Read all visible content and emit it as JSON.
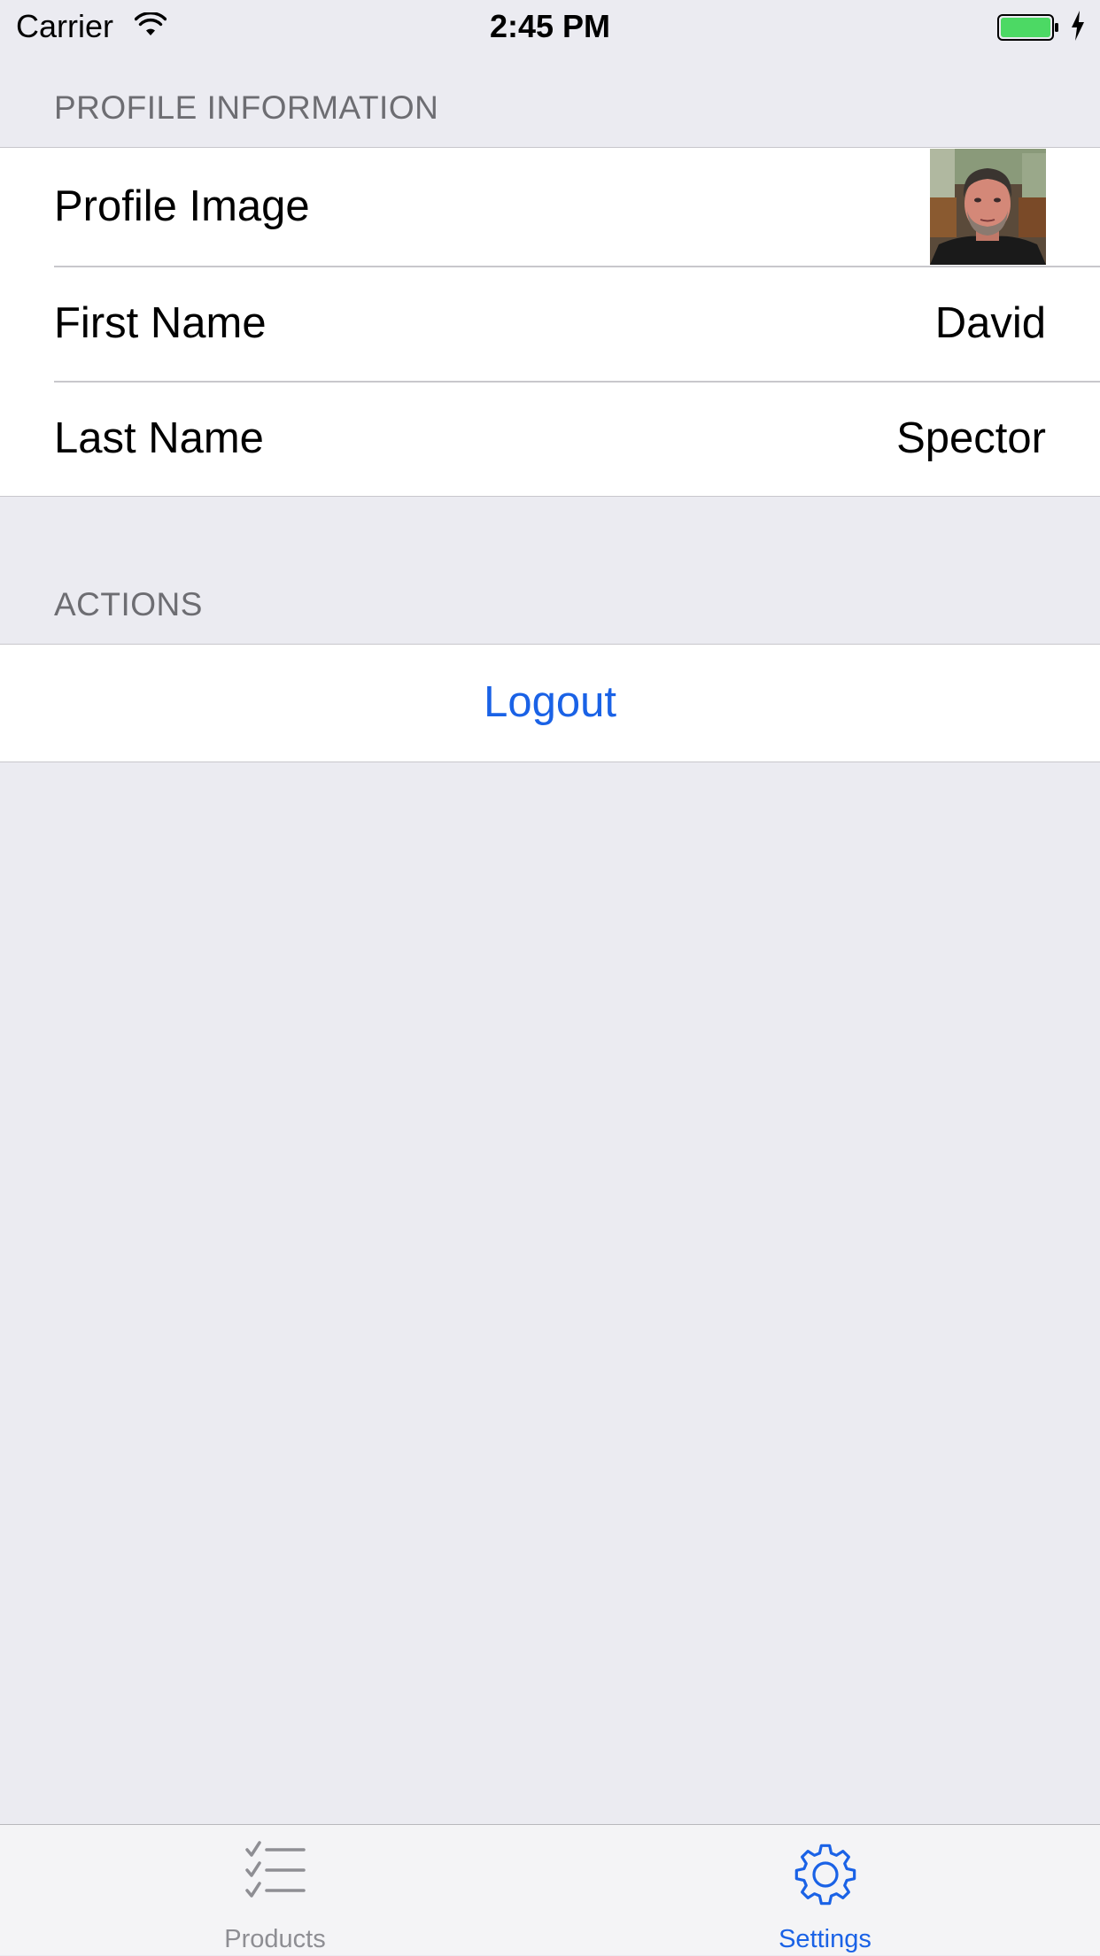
{
  "status_bar": {
    "carrier": "Carrier",
    "time": "2:45 PM",
    "battery_color": "#4CD964"
  },
  "sections": {
    "profile_information": {
      "header": "PROFILE INFORMATION",
      "rows": {
        "profile_image": {
          "label": "Profile Image"
        },
        "first_name": {
          "label": "First Name",
          "value": "David"
        },
        "last_name": {
          "label": "Last Name",
          "value": "Spector"
        }
      }
    },
    "actions": {
      "header": "ACTIONS",
      "logout_label": "Logout"
    }
  },
  "tab_bar": {
    "tabs": [
      {
        "label": "Products",
        "icon": "checklist-icon",
        "selected": false
      },
      {
        "label": "Settings",
        "icon": "gear-icon",
        "selected": true
      }
    ]
  },
  "colors": {
    "background": "#EBEBF1",
    "accent": "#1A62E6",
    "header_text": "#6D6D72",
    "tab_inactive": "#8E8E93",
    "separator": "#C8C7CC"
  }
}
